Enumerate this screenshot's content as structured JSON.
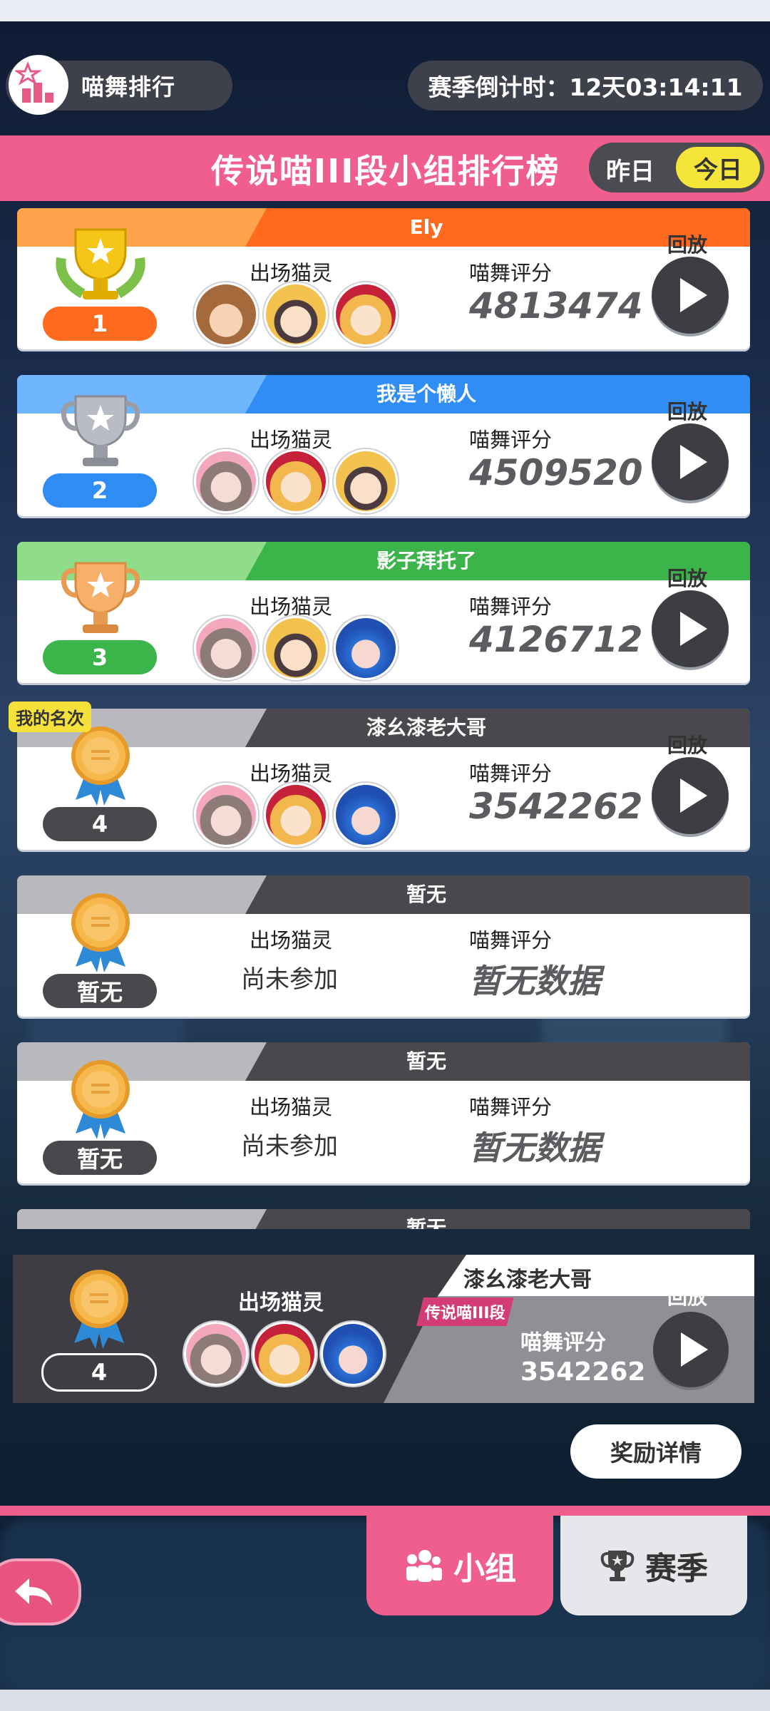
{
  "header": {
    "title": "喵舞排行",
    "countdown": "赛季倒计时：12天03:14:11"
  },
  "board": {
    "title": "传说喵III段小组排行榜",
    "toggle_yesterday": "昨日",
    "toggle_today": "今日"
  },
  "labels": {
    "cats": "出场猫灵",
    "score": "喵舞评分",
    "replay": "回放",
    "no_data": "暂无数据",
    "not_joined": "尚未参加",
    "my_rank": "我的名次"
  },
  "rows": [
    {
      "rank": "1",
      "name": "Ely",
      "score": "4813474"
    },
    {
      "rank": "2",
      "name": "我是个懒人",
      "score": "4509520"
    },
    {
      "rank": "3",
      "name": "影子拜托了",
      "score": "4126712"
    },
    {
      "rank": "4",
      "name": "漆幺漆老大哥",
      "score": "3542262"
    },
    {
      "rank": "暂无",
      "name": "暂无"
    },
    {
      "rank": "暂无",
      "name": "暂无"
    },
    {
      "name": "暂无"
    }
  ],
  "me": {
    "rank": "4",
    "name": "漆幺漆老大哥",
    "tier": "传说喵III段",
    "score": "3542262"
  },
  "reward_button": "奖励详情",
  "tabs": {
    "group": "小组",
    "season": "赛季"
  },
  "colors": {
    "pink": "#ef5e8c",
    "gold_stripe": "#ff6a1f",
    "blue_stripe": "#2f8df4",
    "green_stripe": "#3bb54a",
    "gray_stripe": "#a5a5a8",
    "today_yellow": "#f5e53a"
  }
}
